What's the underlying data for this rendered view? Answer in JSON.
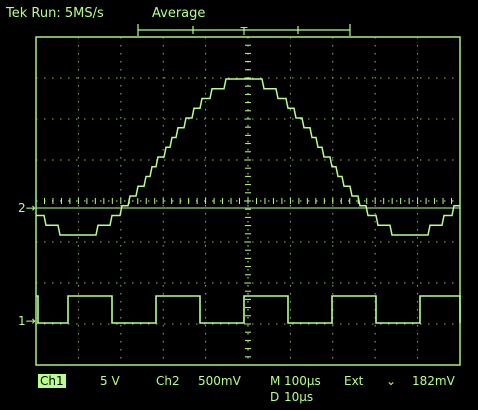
{
  "header": {
    "status": "Tek Run: 5MS/s",
    "acquisition": "Average",
    "trigger_marker": "T"
  },
  "markers": {
    "ch2": "2→",
    "ch1": "1→"
  },
  "readout": {
    "ch1_label": "Ch1",
    "ch1_scale": "5 V",
    "ch2_label": "Ch2",
    "ch2_scale": "500mV",
    "m_label": "M",
    "m_value": "100µs",
    "d_label": "D",
    "d_value": "10µs",
    "trigger_source": "Ext",
    "trigger_slope": "⌄",
    "trigger_level": "182mV"
  },
  "colors": {
    "trace": "#b6ff8c",
    "grid": "#9ee07a",
    "background": "#000000"
  }
}
